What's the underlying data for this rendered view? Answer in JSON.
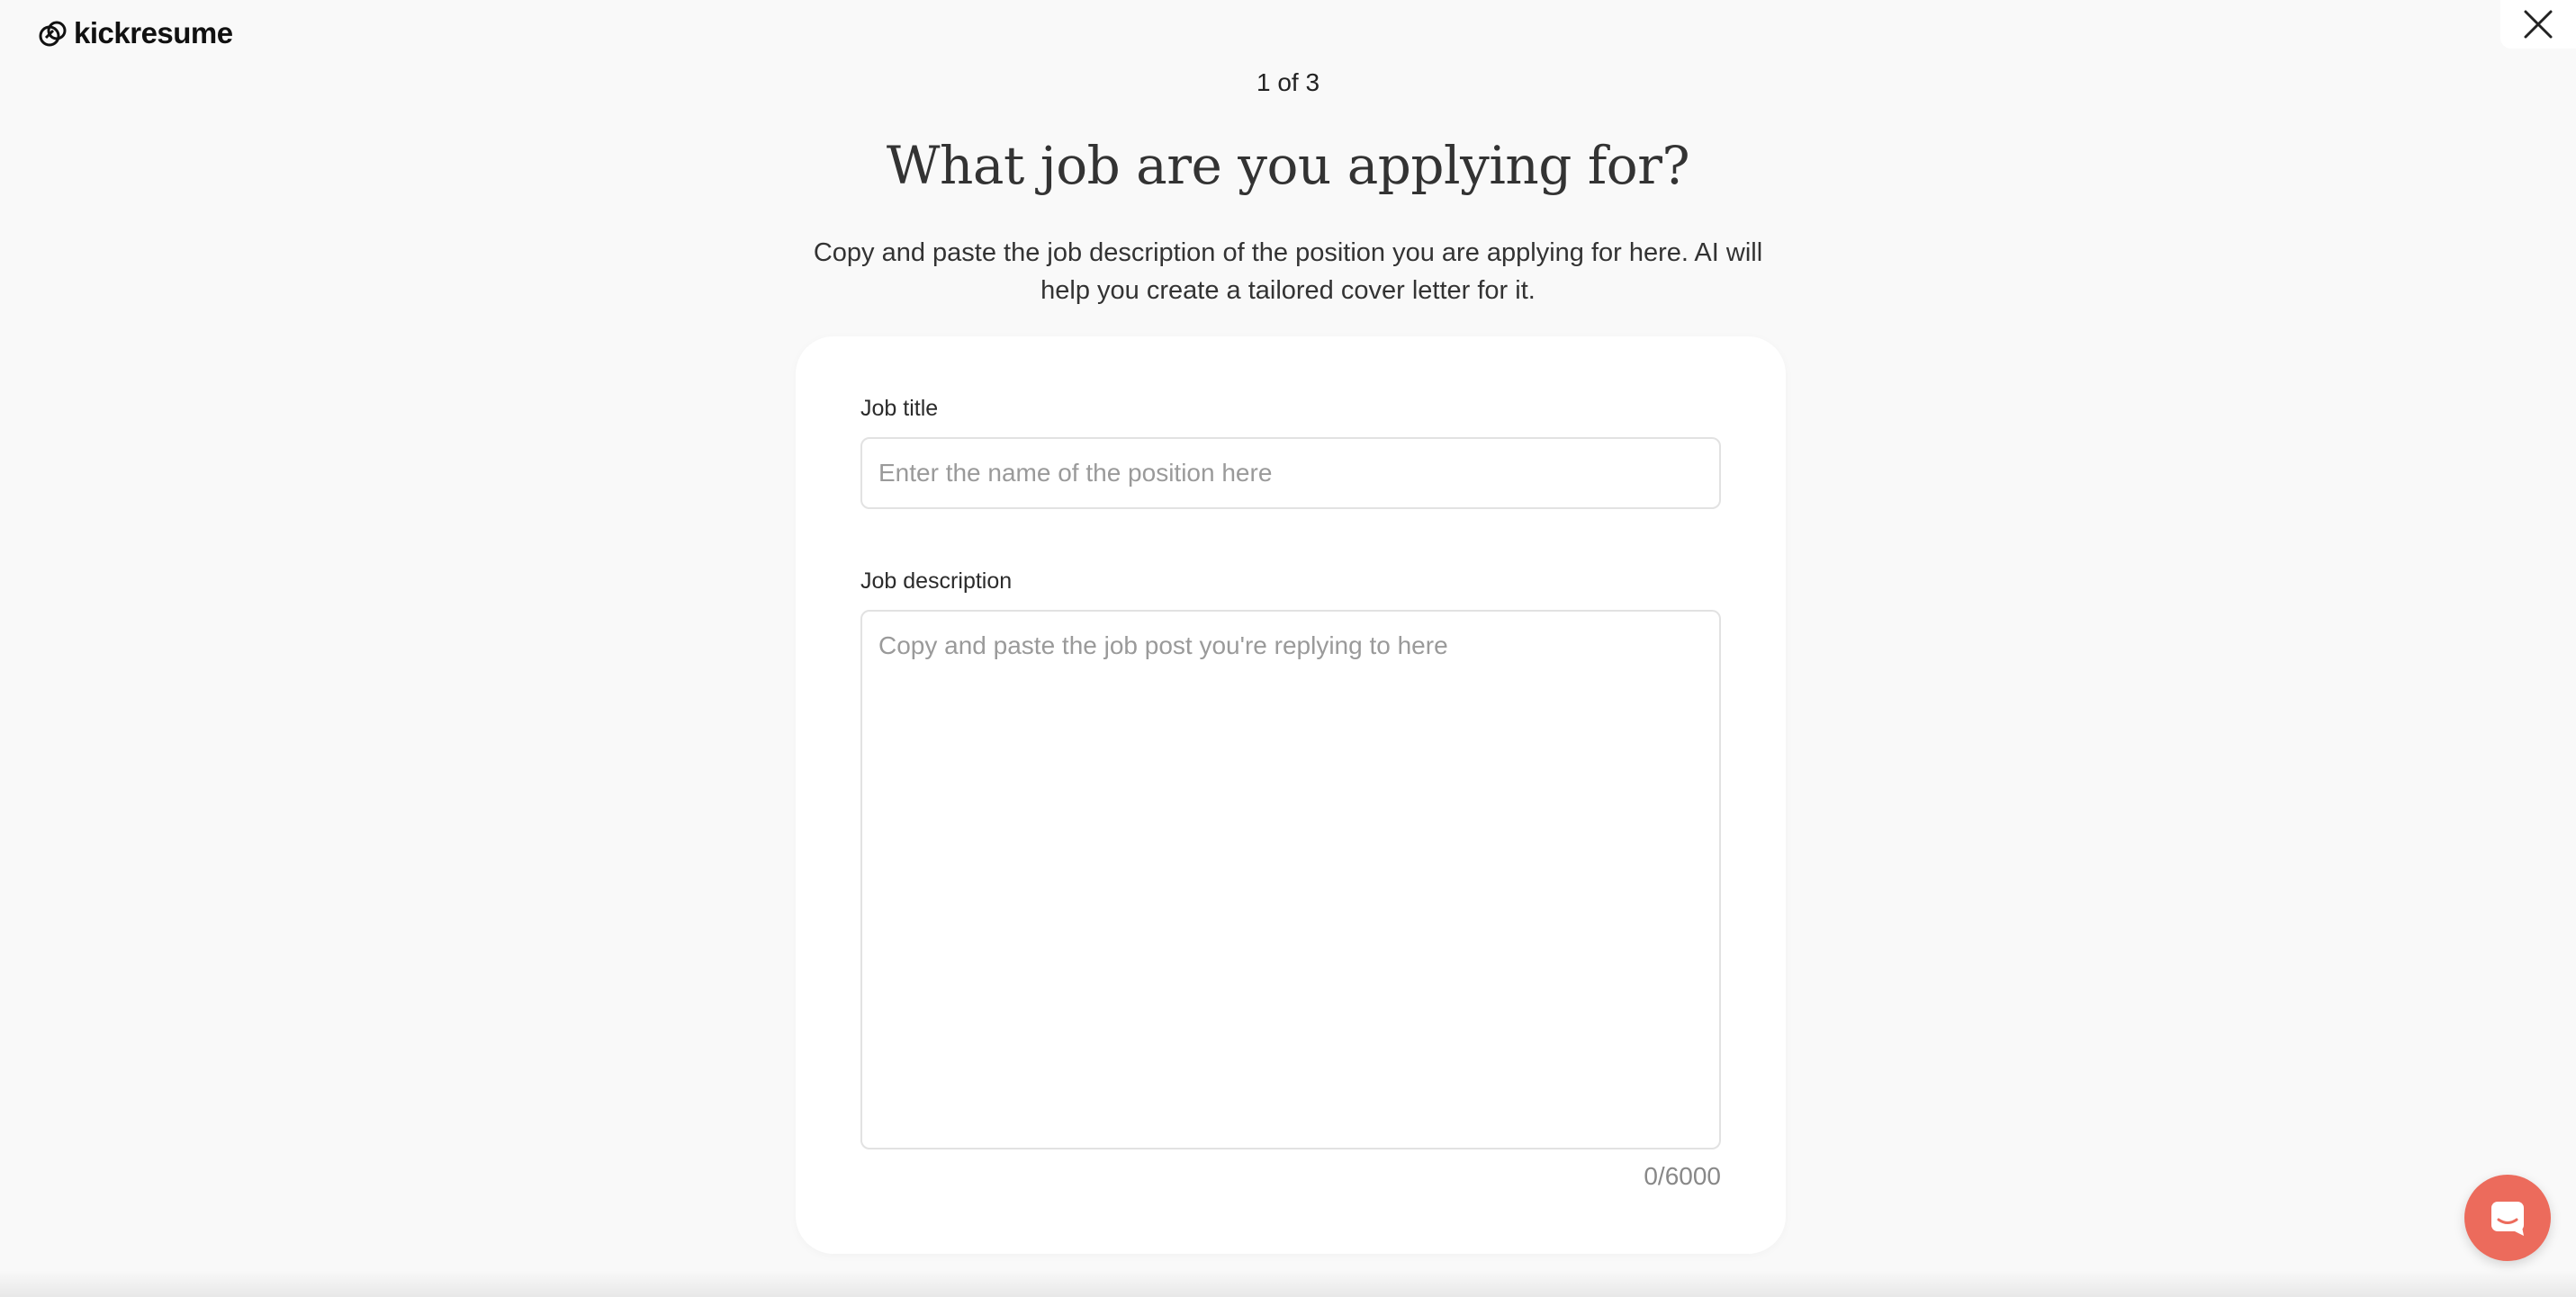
{
  "brand": {
    "name": "kickresume"
  },
  "step": {
    "text": "1 of 3"
  },
  "heading": {
    "title": "What job are you applying for?",
    "subtitle": "Copy and paste the job description of the position you are applying for here. AI will help you create a tailored cover letter for it."
  },
  "form": {
    "job_title": {
      "label": "Job title",
      "value": "",
      "placeholder": "Enter the name of the position here"
    },
    "job_description": {
      "label": "Job description",
      "value": "",
      "placeholder": "Copy and paste the job post you're replying to here",
      "counter": "0/6000"
    }
  },
  "icons": {
    "close": "close-icon",
    "chat": "chat-icon",
    "logo": "kickresume-logo-icon"
  },
  "colors": {
    "background": "#f9f9f9",
    "card": "#ffffff",
    "chat_button": "#ec6b5c"
  }
}
